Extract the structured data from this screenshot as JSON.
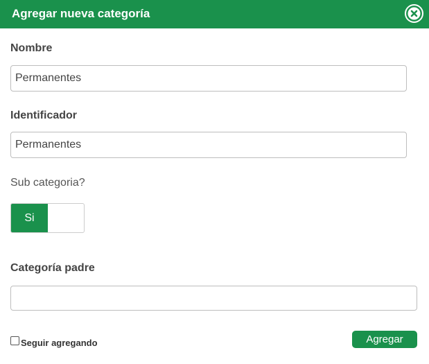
{
  "dialog": {
    "title": "Agregar nueva categoría",
    "close_icon": "close-circle-icon"
  },
  "form": {
    "name": {
      "label": "Nombre",
      "value": "Permanentes"
    },
    "identifier": {
      "label": "Identificador",
      "value": "Permanentes"
    },
    "subcategory": {
      "label": "Sub categoria?",
      "toggle_on_label": "Si",
      "checked": true
    },
    "parent_category": {
      "label": "Categoría padre",
      "value": ""
    },
    "keep_adding": {
      "label": "Seguir agregando",
      "checked": false
    },
    "submit_label": "Agregar"
  },
  "colors": {
    "accent": "#1a914c",
    "text": "#444444",
    "border": "#bdbdbd"
  }
}
